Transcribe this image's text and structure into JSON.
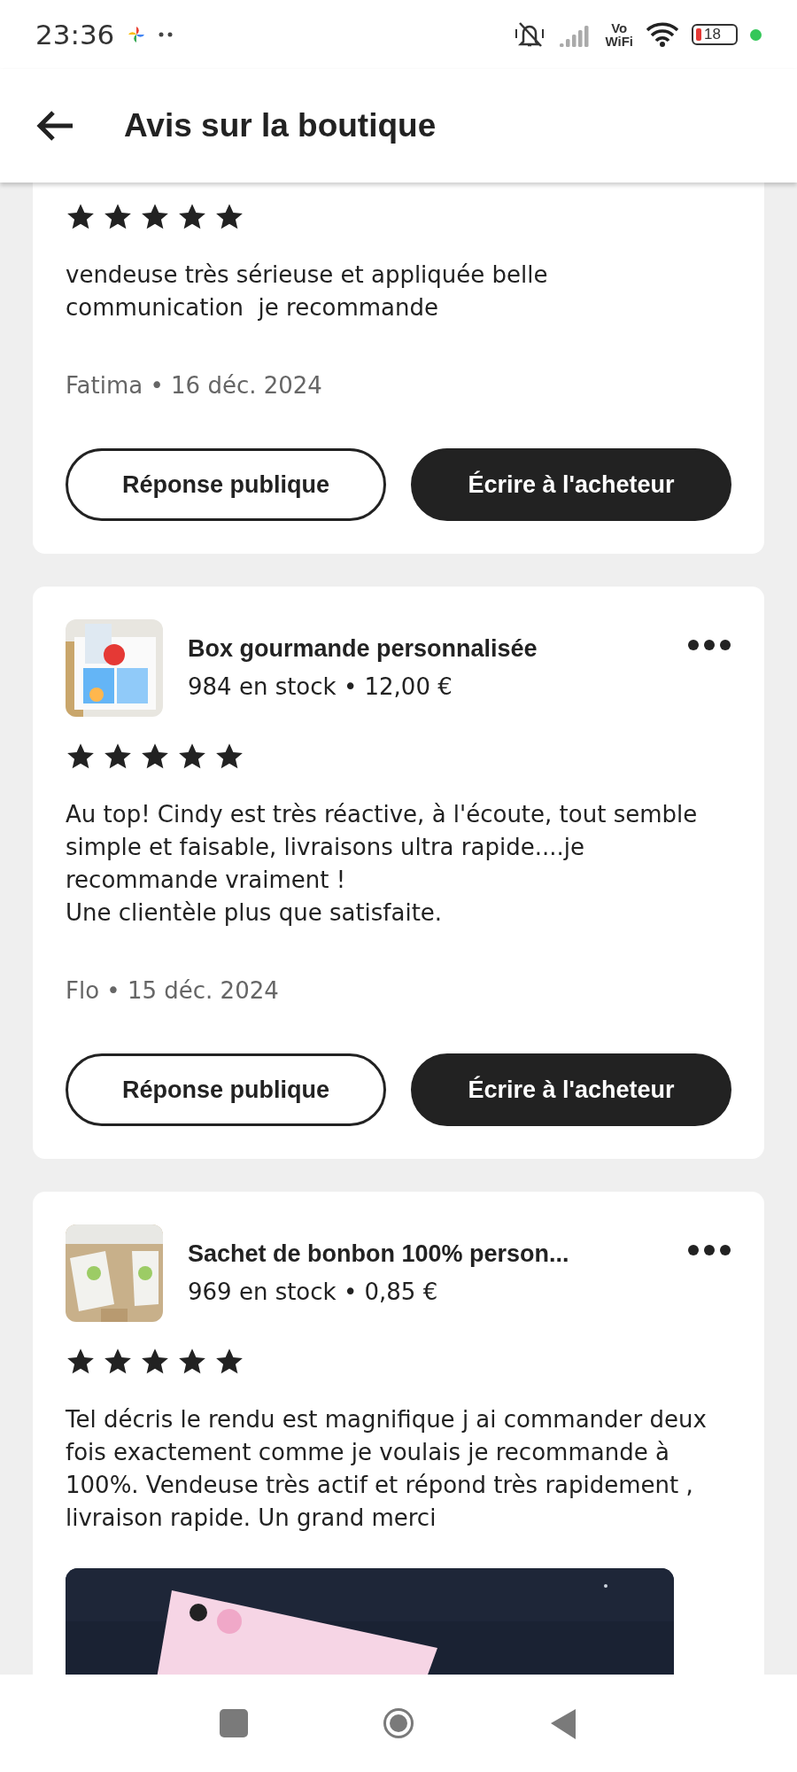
{
  "status_bar": {
    "time": "23:36",
    "network_label_top": "Vo",
    "network_label_bottom": "WiFi",
    "battery": "18"
  },
  "header": {
    "title": "Avis sur la boutique"
  },
  "reviews": [
    {
      "stars": 5,
      "text": "vendeuse très sérieuse et appliquée belle communication  je recommande",
      "byline": "Fatima • 16 déc. 2024",
      "buttons": [
        {
          "label": "Réponse publique",
          "kind": "outline"
        },
        {
          "label": "Écrire à l'acheteur",
          "kind": "filled"
        }
      ]
    },
    {
      "product": {
        "title": "Box gourmande personnalisée",
        "details": "984 en stock • 12,00 €"
      },
      "stars": 5,
      "text": "Au top! Cindy est très réactive, à l'écoute, tout semble simple et faisable, livraisons ultra rapide....je recommande vraiment !\nUne clientèle plus que satisfaite.",
      "byline": "Flo • 15 déc. 2024",
      "buttons": [
        {
          "label": "Réponse publique",
          "kind": "outline"
        },
        {
          "label": "Écrire à l'acheteur",
          "kind": "filled"
        }
      ]
    },
    {
      "product": {
        "title": "Sachet de bonbon 100% person...",
        "details": "969 en stock • 0,85 €"
      },
      "stars": 5,
      "text": "Tel décris le rendu est magnifique j ai commander deux fois exactement comme je voulais je recommande à 100%. Vendeuse très actif et répond très rapidement , livraison rapide. Un grand merci"
    }
  ]
}
